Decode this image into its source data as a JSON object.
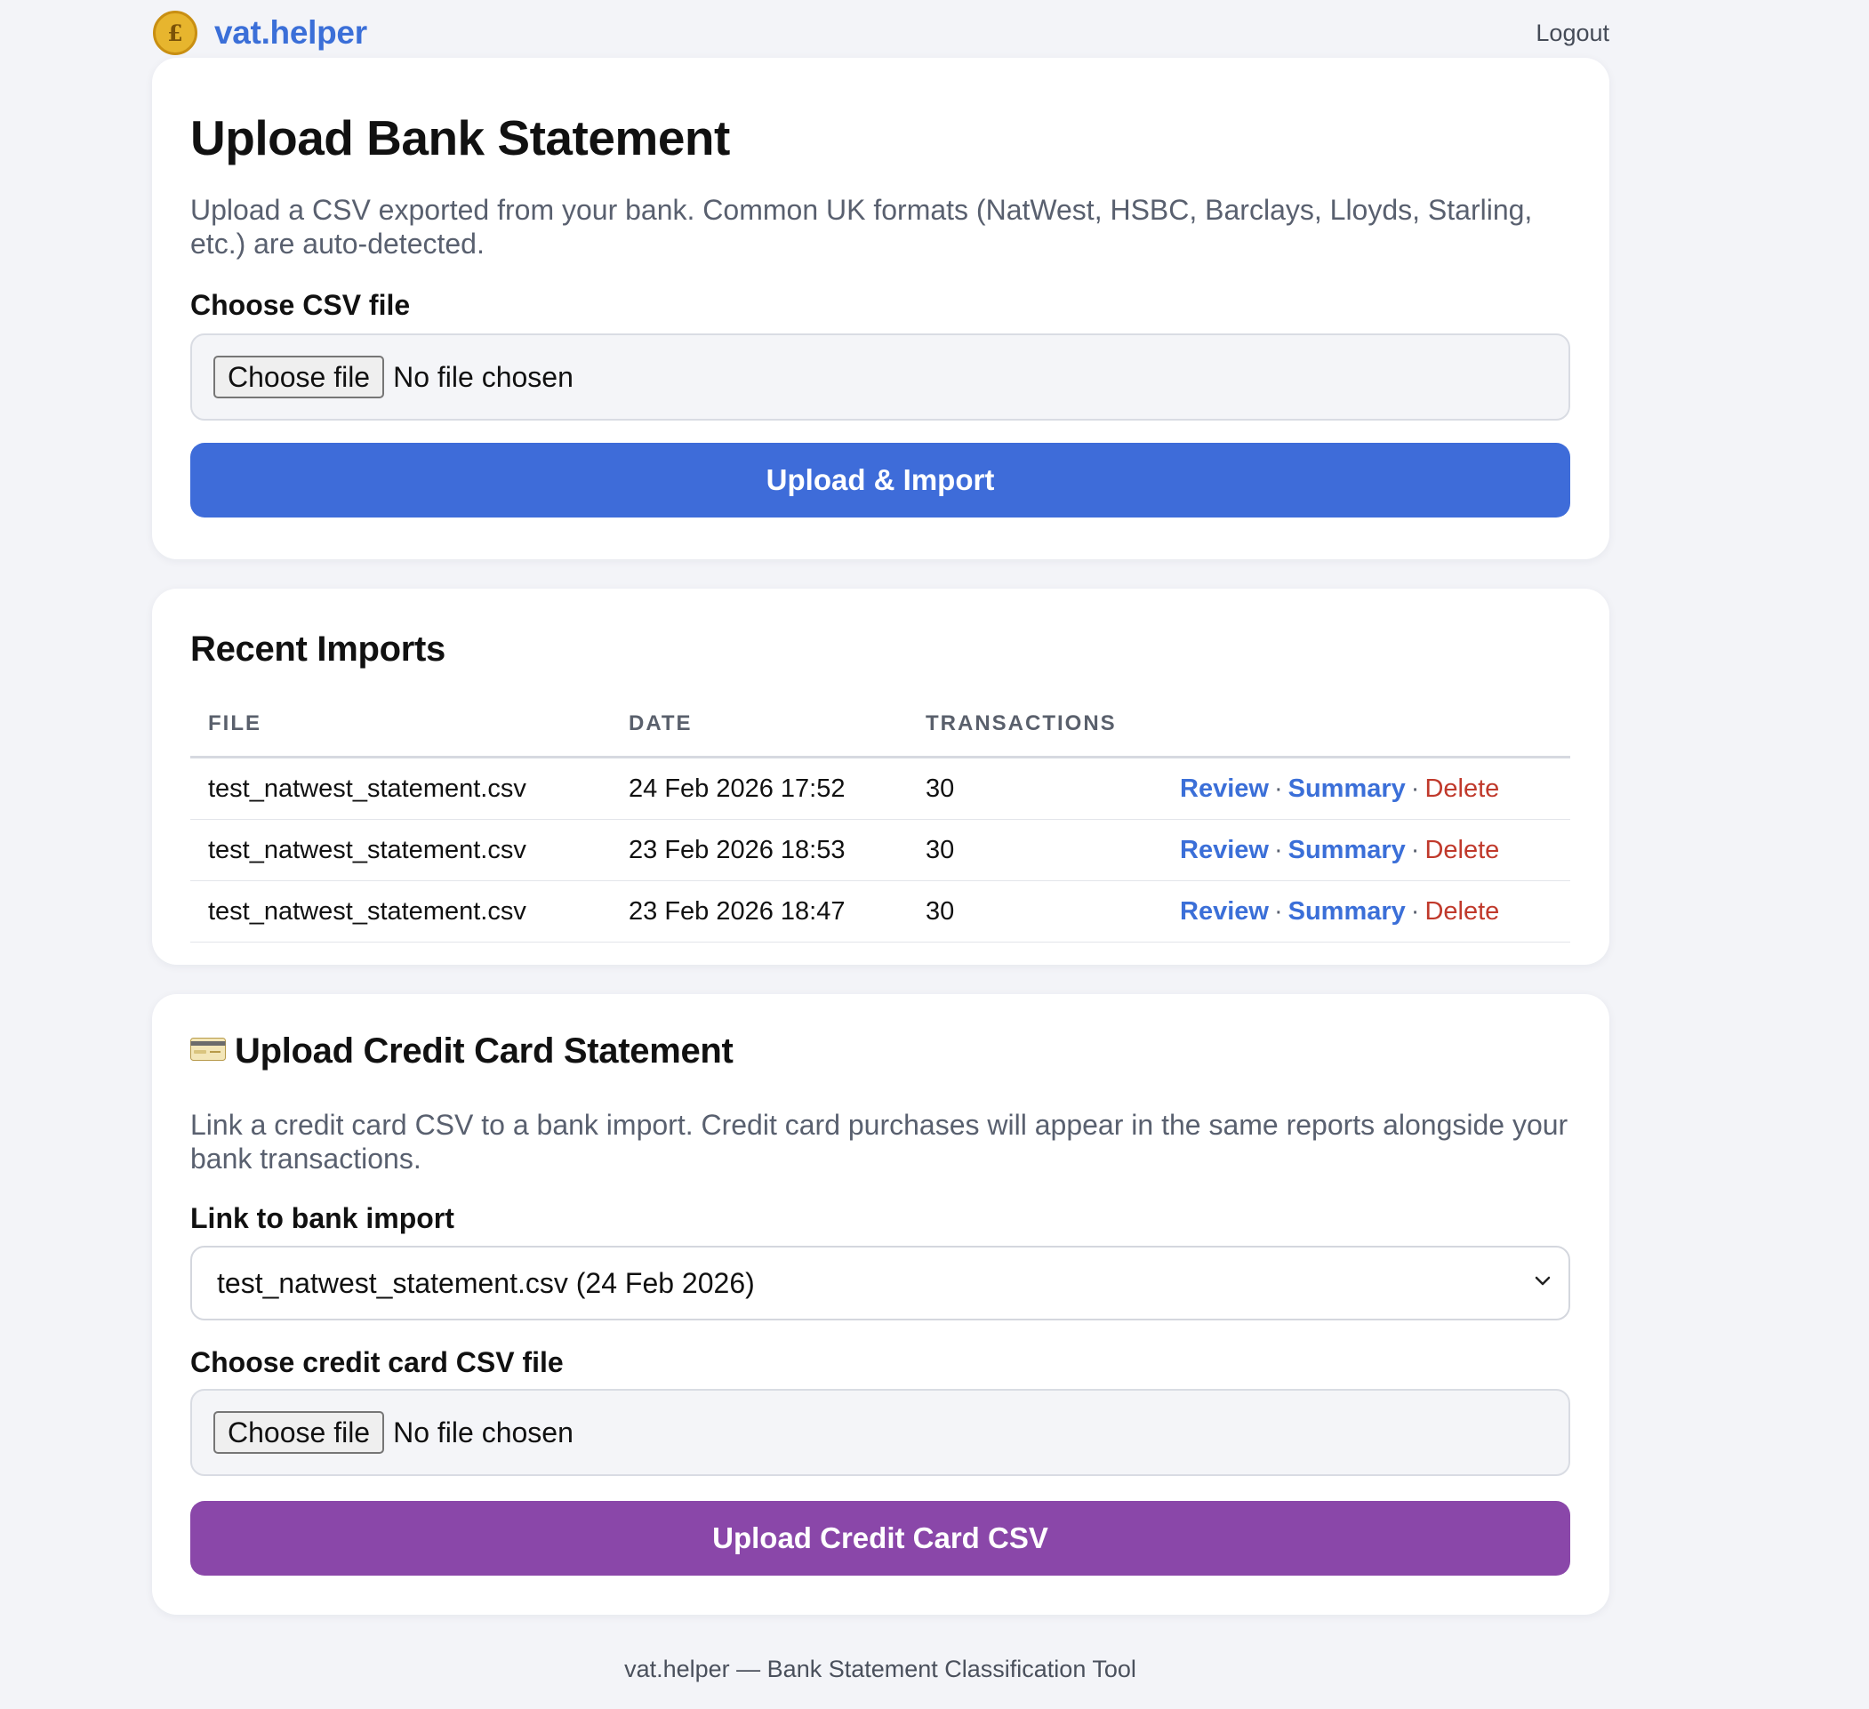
{
  "header": {
    "brand": "vat.helper",
    "coin_symbol": "£",
    "logout_label": "Logout"
  },
  "bank_upload": {
    "title": "Upload Bank Statement",
    "description": "Upload a CSV exported from your bank. Common UK formats (NatWest, HSBC, Barclays, Lloyds, Starling, etc.) are auto-detected.",
    "file_label": "Choose CSV file",
    "choose_button": "Choose file",
    "no_file": "No file chosen",
    "submit_label": "Upload & Import"
  },
  "recent_imports": {
    "title": "Recent Imports",
    "columns": [
      "FILE",
      "DATE",
      "TRANSACTIONS",
      ""
    ],
    "rows": [
      {
        "file": "test_natwest_statement.csv",
        "date": "24 Feb 2026 17:52",
        "transactions": "30"
      },
      {
        "file": "test_natwest_statement.csv",
        "date": "23 Feb 2026 18:53",
        "transactions": "30"
      },
      {
        "file": "test_natwest_statement.csv",
        "date": "23 Feb 2026 18:47",
        "transactions": "30"
      }
    ],
    "actions": {
      "review": "Review",
      "summary": "Summary",
      "delete": "Delete",
      "separator": "·"
    }
  },
  "credit_upload": {
    "title": "Upload Credit Card Statement",
    "icon": "credit-card-icon",
    "description": "Link a credit card CSV to a bank import. Credit card purchases will appear in the same reports alongside your bank transactions.",
    "link_label": "Link to bank import",
    "selected_import": "test_natwest_statement.csv (24 Feb 2026)",
    "file_label": "Choose credit card CSV file",
    "choose_button": "Choose file",
    "no_file": "No file chosen",
    "submit_label": "Upload Credit Card CSV"
  },
  "footer": {
    "text": "vat.helper — Bank Statement Classification Tool"
  },
  "colors": {
    "accent_blue": "#3e6cd9",
    "accent_purple": "#8a47a9",
    "delete_red": "#c0392b",
    "page_bg": "#f3f4f8"
  }
}
